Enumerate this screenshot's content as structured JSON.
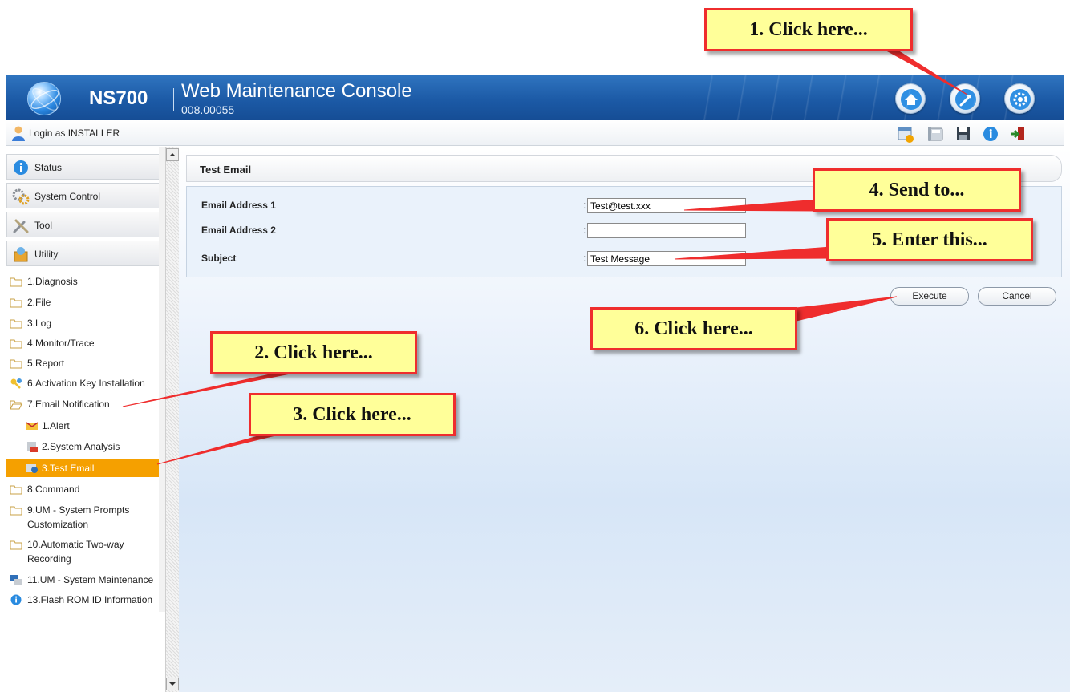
{
  "header": {
    "product": "NS700",
    "title": "Web Maintenance Console",
    "version": "008.00055",
    "buttons": [
      "home-icon",
      "tool-icon",
      "settings-icon"
    ]
  },
  "login_bar": {
    "text": "Login as INSTALLER",
    "icons": [
      "notification-icon",
      "phone-icon",
      "save-icon",
      "info-icon",
      "logout-icon"
    ]
  },
  "sidebar": {
    "sections": [
      {
        "label": "Status",
        "icon": "status-icon"
      },
      {
        "label": "System Control",
        "icon": "system-control-icon"
      },
      {
        "label": "Tool",
        "icon": "tool-icon"
      },
      {
        "label": "Utility",
        "icon": "utility-icon"
      }
    ],
    "items": [
      {
        "label": "1.Diagnosis",
        "icon": "folder-icon"
      },
      {
        "label": "2.File",
        "icon": "folder-icon"
      },
      {
        "label": "3.Log",
        "icon": "folder-icon"
      },
      {
        "label": "4.Monitor/Trace",
        "icon": "folder-icon"
      },
      {
        "label": "5.Report",
        "icon": "folder-icon"
      },
      {
        "label": "6.Activation Key Installation",
        "icon": "key-icon"
      },
      {
        "label": "7.Email Notification",
        "icon": "open-folder-icon"
      },
      {
        "label": "1.Alert",
        "icon": "mail-icon"
      },
      {
        "label": "2.System Analysis",
        "icon": "analysis-icon"
      },
      {
        "label": "3.Test Email",
        "icon": "test-email-icon",
        "selected": true
      },
      {
        "label": "8.Command",
        "icon": "folder-icon"
      },
      {
        "label": "9.UM - System Prompts",
        "label2": "Customization",
        "icon": "folder-icon"
      },
      {
        "label": "10.Automatic Two-way",
        "label2": "Recording",
        "icon": "folder-icon"
      },
      {
        "label": "11.UM - System Maintenance",
        "icon": "maintenance-icon"
      },
      {
        "label": "13.Flash ROM ID Information",
        "icon": "info-icon"
      }
    ]
  },
  "main": {
    "title": "Test Email",
    "fields": [
      {
        "label": "Email Address 1",
        "value": "Test@test.xxx"
      },
      {
        "label": "Email Address 2",
        "value": ""
      },
      {
        "label": "Subject",
        "value": "Test Message"
      }
    ],
    "colon": ":",
    "execute_label": "Execute",
    "cancel_label": "Cancel"
  },
  "callouts": {
    "c1": "1. Click here...",
    "c2": "2. Click here...",
    "c3": "3. Click here...",
    "c4": "4. Send to...",
    "c5": "5. Enter this...",
    "c6": "6. Click here..."
  },
  "colors": {
    "header_blue": "#1c5aa6",
    "selected_item": "#f5a000",
    "callout_fill": "#ffff99",
    "callout_border": "#ef2d2d"
  }
}
